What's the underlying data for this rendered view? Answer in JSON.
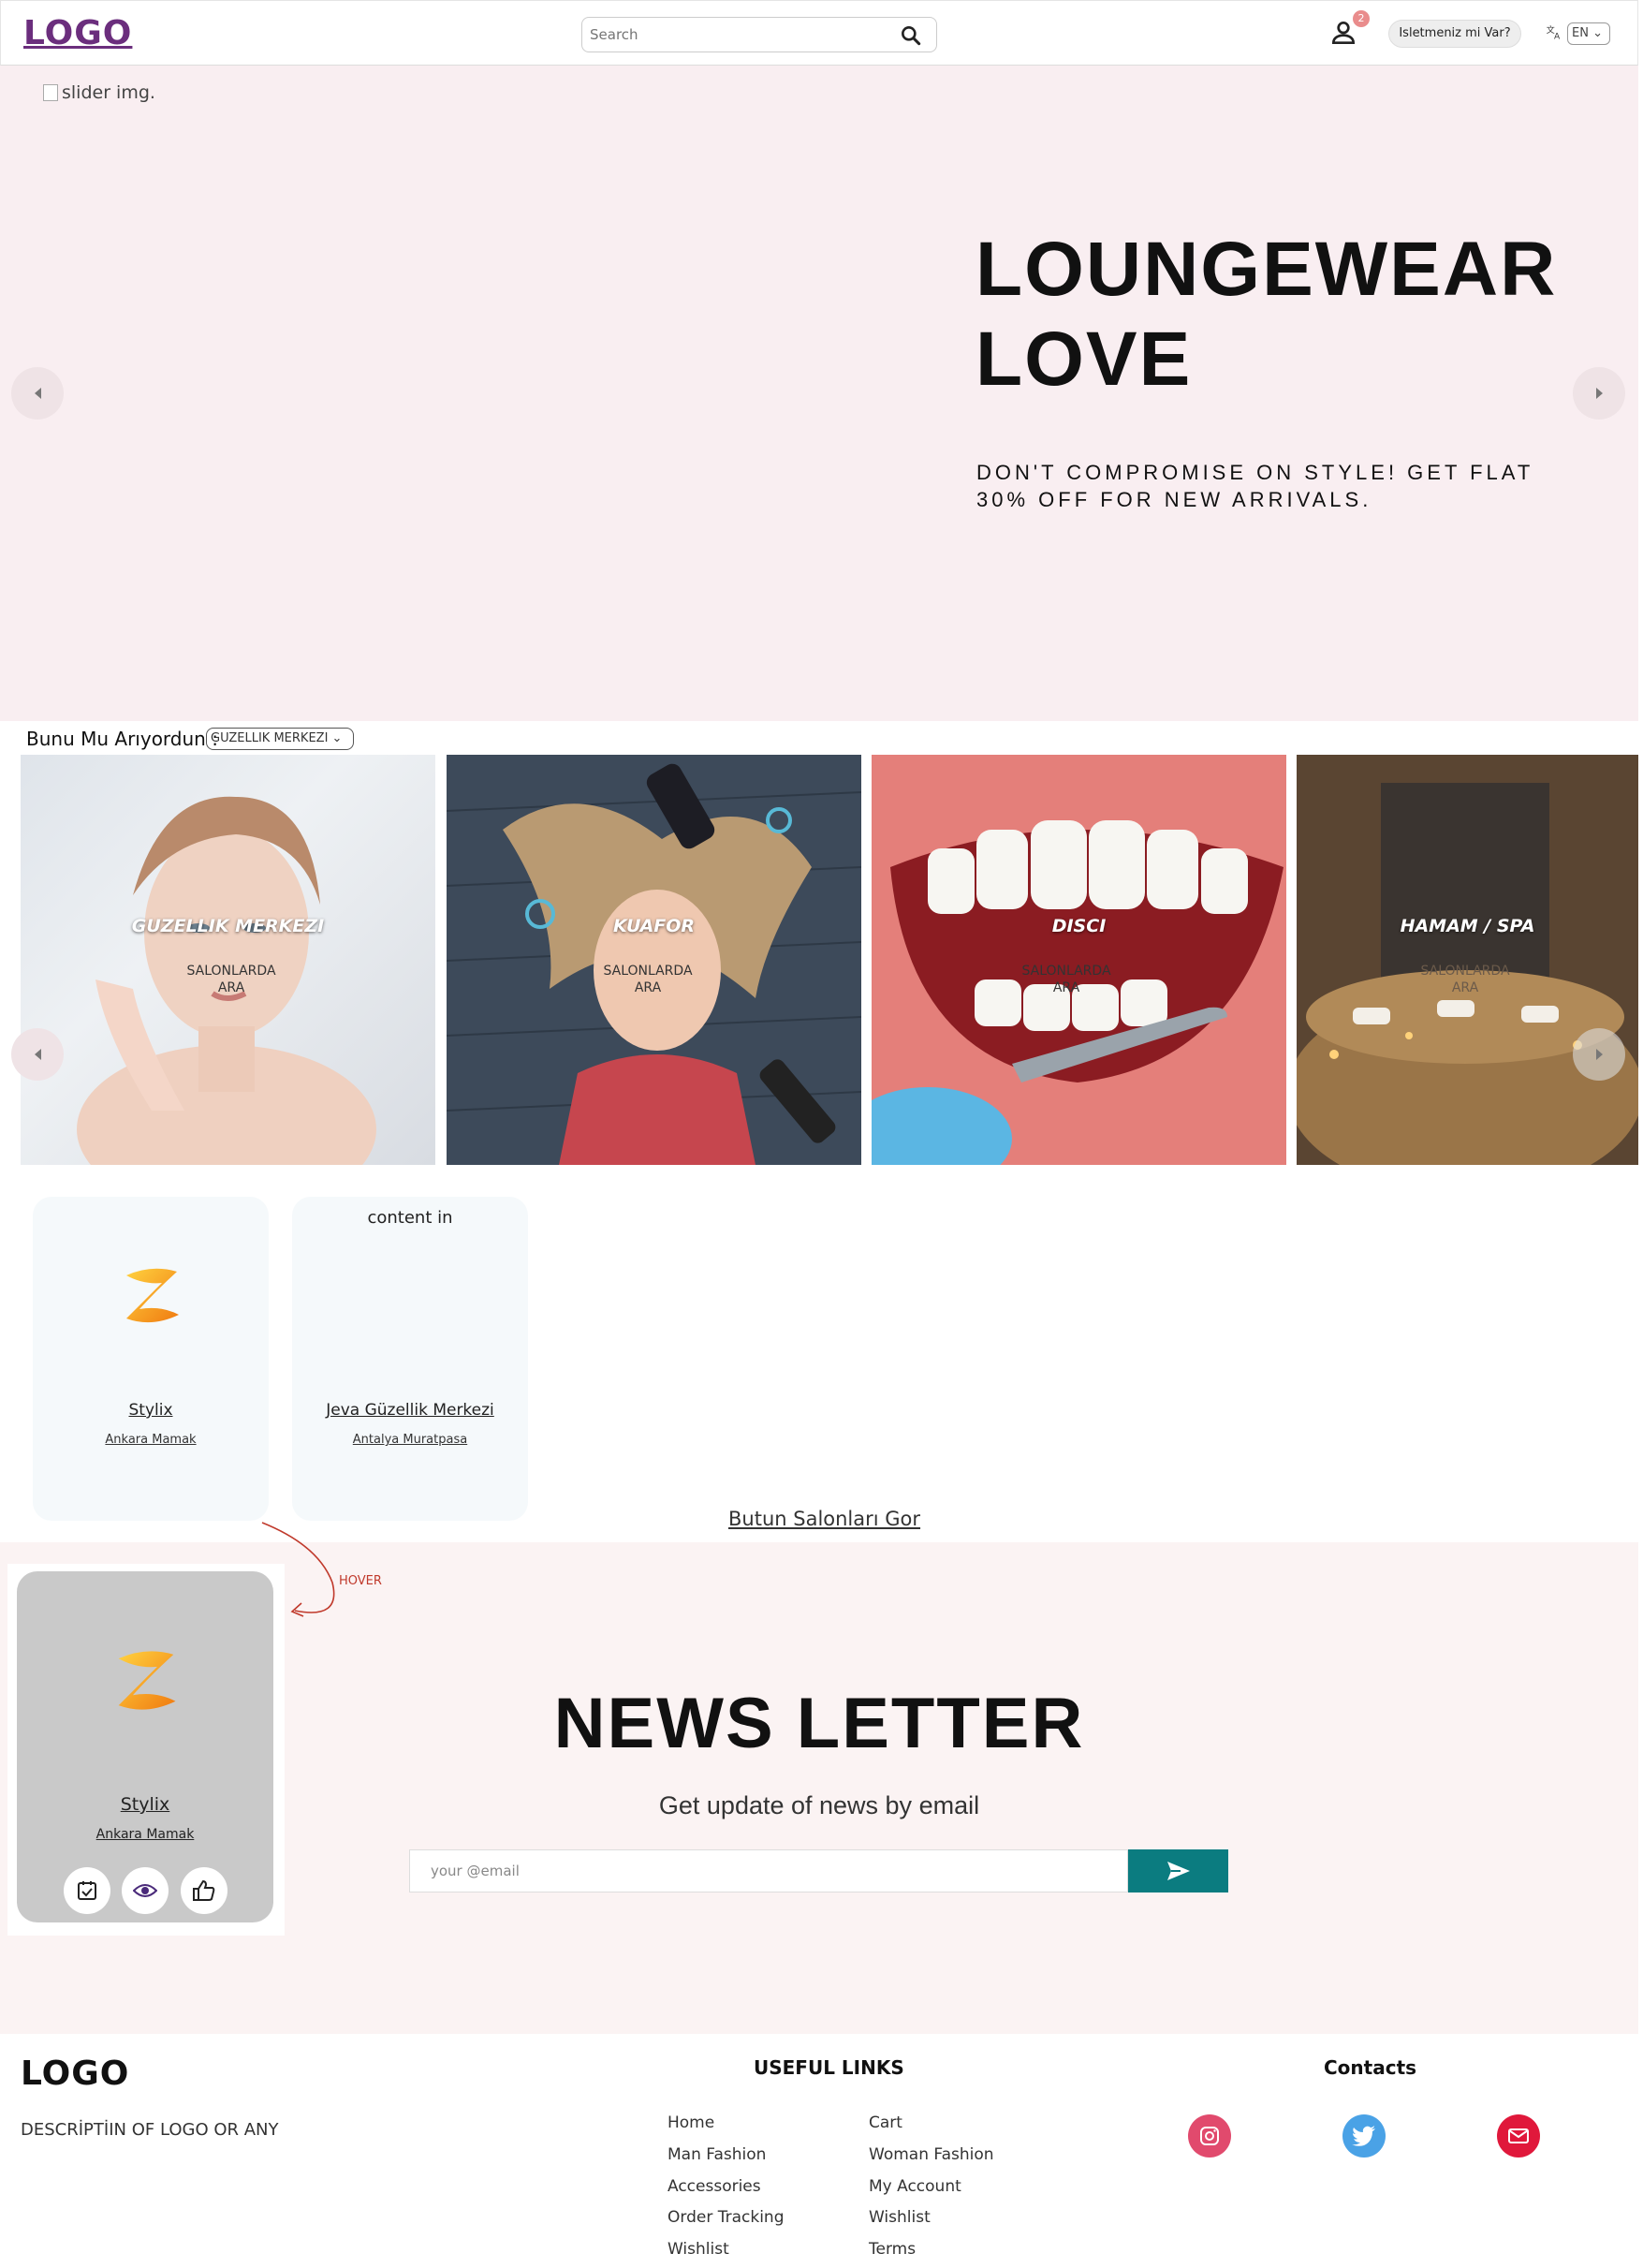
{
  "header": {
    "logo": "LOGO",
    "search_placeholder": "Search",
    "notification_count": "2",
    "business_button": "Isletmeniz mi Var?",
    "language": "EN"
  },
  "hero": {
    "image_alt": "slider img.",
    "title": "LOUNGEWEAR LOVE",
    "subtitle": "DON'T COMPROMISE ON STYLE! GET FLAT 30% OFF FOR NEW ARRIVALS."
  },
  "categories": {
    "label": "Bunu Mu Arıyordun :",
    "selected": "GUZELLIK MERKEZI",
    "items": [
      {
        "title": "GUZELLIK MERKEZI",
        "sub": "SALONLARDA ARA"
      },
      {
        "title": "KUAFOR",
        "sub": "SALONLARDA ARA"
      },
      {
        "title": "DISCI",
        "sub": "SALONLARDA ARA"
      },
      {
        "title": "HAMAM / SPA",
        "sub": "SALONLARDA ARA"
      }
    ]
  },
  "salons": {
    "items": [
      {
        "name": "Stylix",
        "location": "Ankara Mamak"
      },
      {
        "name": "Jeva Güzellik Merkezi",
        "location": "Antalya Muratpasa",
        "overlay": "content in"
      }
    ],
    "all_link": "Butun Salonları Gor"
  },
  "hover_demo": {
    "note": "HOVER",
    "name": "Stylix",
    "location": "Ankara Mamak"
  },
  "newsletter": {
    "title": "NEWS LETTER",
    "subtitle": "Get update of news by email",
    "email_placeholder": "your @email",
    "accent": "#0b7c80"
  },
  "footer": {
    "logo": "LOGO",
    "description": "DESCRİPTİIN OF LOGO OR ANY",
    "useful_links_heading": "USEFUL LINKS",
    "links_col1": [
      "Home",
      "Man Fashion",
      "Accessories",
      "Order Tracking",
      "Wishlist"
    ],
    "links_col2": [
      "Cart",
      "Woman Fashion",
      "My Account",
      "Wishlist",
      "Terms"
    ],
    "contacts_heading": "Contacts",
    "social": [
      "instagram-icon",
      "twitter-icon",
      "mail-icon"
    ]
  }
}
